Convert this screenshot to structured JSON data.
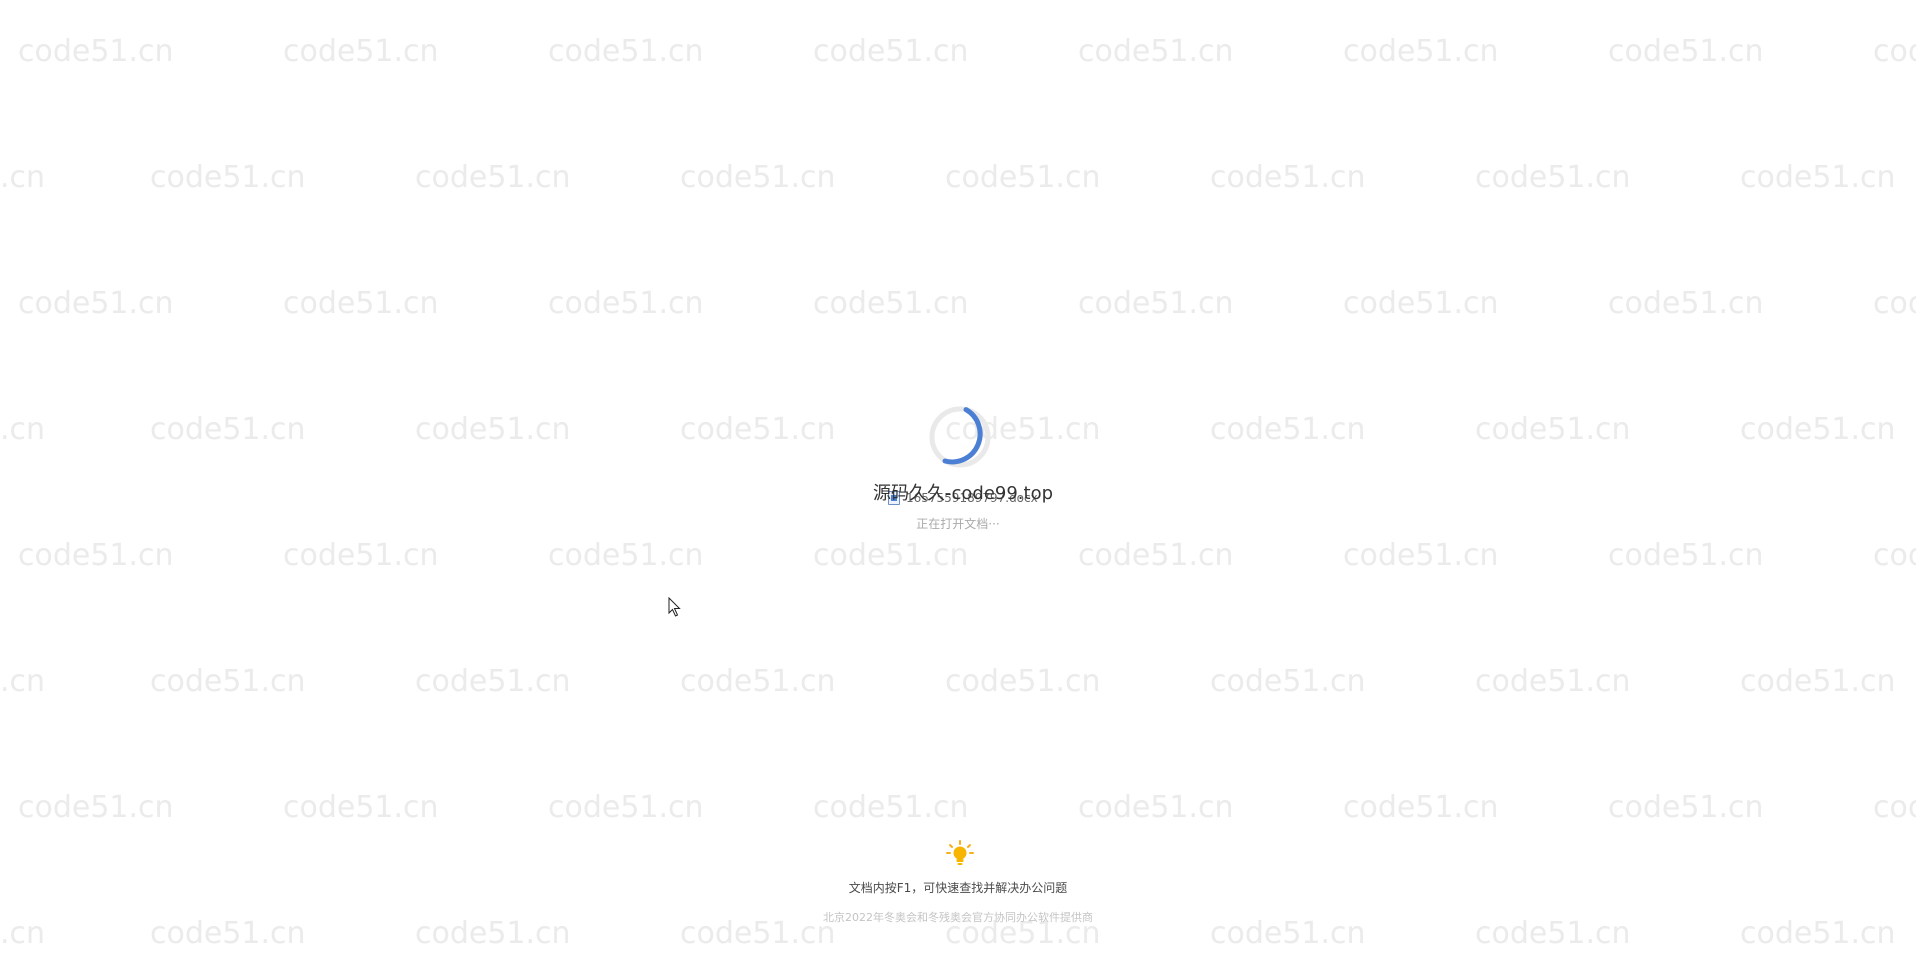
{
  "watermark": {
    "text": "code51.cn",
    "edge_fragment_left": ".cn",
    "edge_fragment_right": "coo"
  },
  "overlay": {
    "title": "源码久久-code99.top"
  },
  "loading": {
    "file_name": "1657559189797.docx",
    "status": "正在打开文档···",
    "accent_color": "#4a7fd4"
  },
  "tip": {
    "text": "文档内按F1，可快速查找并解决办公问题"
  },
  "footer": {
    "text": "北京2022年冬奥会和冬残奥会官方协同办公软件提供商"
  },
  "icons": {
    "spinner": "loading-spinner-icon",
    "document": "doc-file-icon",
    "bulb": "light-bulb-icon",
    "cursor": "mouse-pointer-icon"
  }
}
